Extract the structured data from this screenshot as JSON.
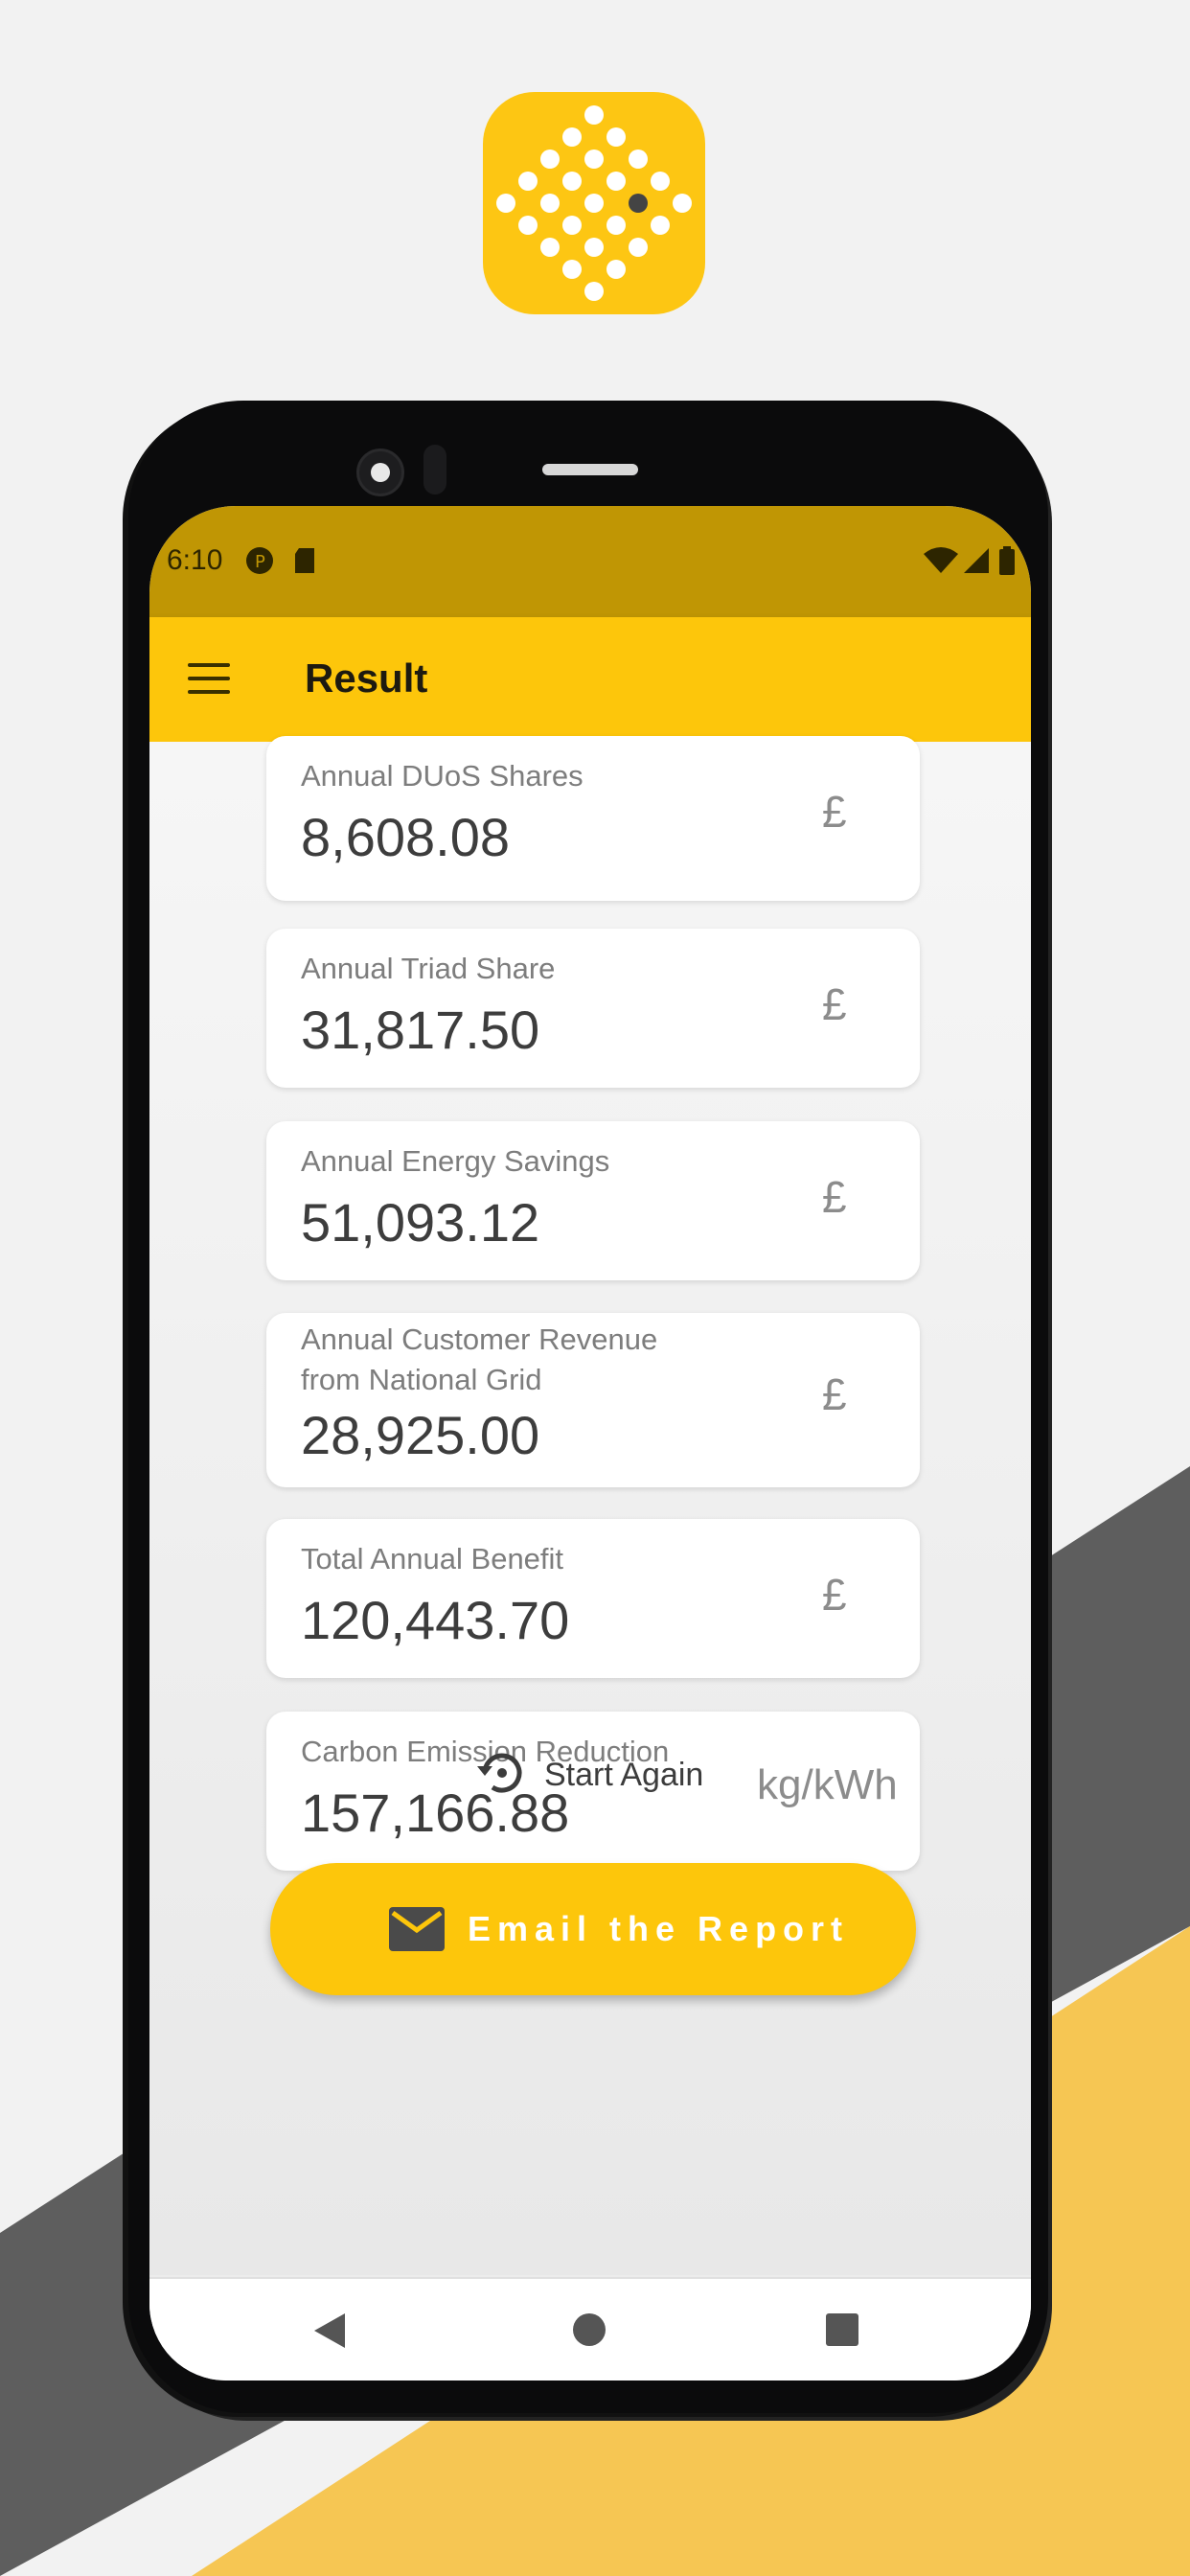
{
  "status_bar": {
    "time": "6:10"
  },
  "app_bar": {
    "title": "Result"
  },
  "results": [
    {
      "label": "Annual DUoS Shares",
      "value": "8,608.08",
      "unit": "£"
    },
    {
      "label": "Annual Triad Share",
      "value": "31,817.50",
      "unit": "£"
    },
    {
      "label": "Annual Energy Savings",
      "value": "51,093.12",
      "unit": "£"
    },
    {
      "label_line1": "Annual Customer Revenue",
      "label_line2": "from National Grid",
      "value": "28,925.00",
      "unit": "£"
    },
    {
      "label": "Total Annual Benefit",
      "value": "120,443.70",
      "unit": "£"
    },
    {
      "label": "Carbon Emission Reduction",
      "value": "157,166.88",
      "unit": "kg/kWh"
    }
  ],
  "actions": {
    "start_again_label": "Start Again",
    "email_label": "Email the Report"
  },
  "colors": {
    "accent": "#fdc60b",
    "status_bar": "#c09604",
    "band_dark": "#5e5e5e",
    "band_yellow": "#f6c653",
    "background": "#f2f2f2"
  },
  "icons": [
    "app-logo-icon",
    "menu-icon",
    "sd-card-icon",
    "wifi-icon",
    "signal-icon",
    "battery-icon",
    "pound-icon",
    "restart-icon",
    "mail-icon",
    "nav-back-icon",
    "nav-home-icon",
    "nav-recent-icon"
  ]
}
